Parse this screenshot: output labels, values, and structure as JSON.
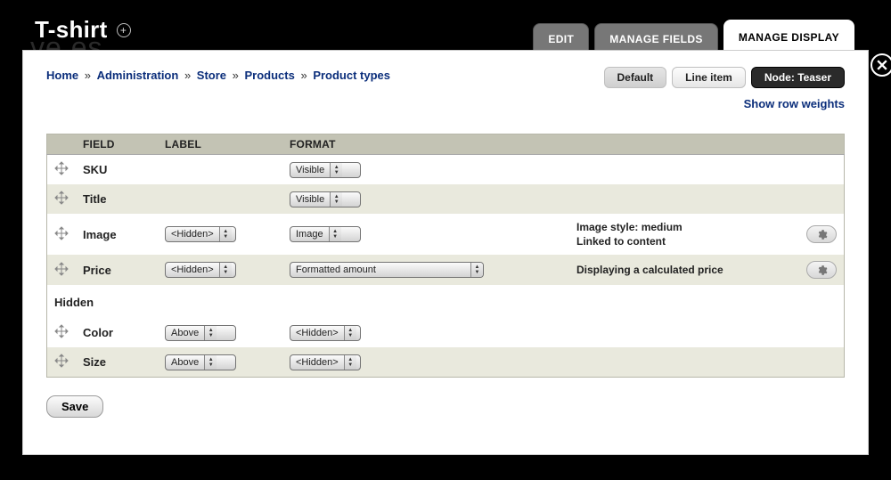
{
  "page": {
    "title": "T-shirt",
    "bg_hint": "ve  es"
  },
  "tabs": [
    {
      "label": "EDIT",
      "active": false
    },
    {
      "label": "MANAGE FIELDS",
      "active": false
    },
    {
      "label": "MANAGE DISPLAY",
      "active": true
    }
  ],
  "breadcrumb": [
    "Home",
    "Administration",
    "Store",
    "Products",
    "Product types"
  ],
  "breadcrumb_sep": "»",
  "view_modes": [
    {
      "label": "Default",
      "style": "default"
    },
    {
      "label": "Line item",
      "style": "normal"
    },
    {
      "label": "Node: Teaser",
      "style": "dark"
    }
  ],
  "row_weights_link": "Show row weights",
  "table": {
    "headers": {
      "field": "FIELD",
      "label": "LABEL",
      "format": "FORMAT"
    },
    "hidden_section": "Hidden"
  },
  "rows": [
    {
      "field": "SKU",
      "label": null,
      "format": "Visible",
      "format_w": "sm",
      "summary": "",
      "has_cog": false,
      "shaded": false
    },
    {
      "field": "Title",
      "label": null,
      "format": "Visible",
      "format_w": "sm",
      "summary": "",
      "has_cog": false,
      "shaded": true
    },
    {
      "field": "Image",
      "label": "<Hidden>",
      "format": "Image",
      "format_w": "md",
      "summary": "Image style: medium\nLinked to content",
      "has_cog": true,
      "shaded": false
    },
    {
      "field": "Price",
      "label": "<Hidden>",
      "format": "Formatted amount",
      "format_w": "lg",
      "summary": "Displaying a calculated price",
      "has_cog": true,
      "shaded": true
    }
  ],
  "hidden_rows": [
    {
      "field": "Color",
      "label": "Above",
      "format": "<Hidden>",
      "shaded": false
    },
    {
      "field": "Size",
      "label": "Above",
      "format": "<Hidden>",
      "shaded": true
    }
  ],
  "save_button": "Save"
}
